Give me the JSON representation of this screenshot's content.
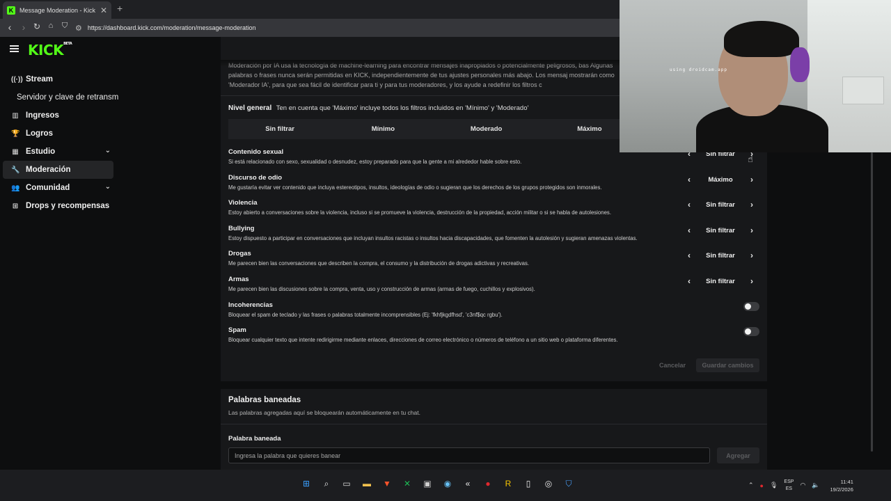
{
  "browser": {
    "tab_title": "Message Moderation - Kick Dash",
    "tab_favicon": "K",
    "url": "https://dashboard.kick.com/moderation/message-moderation"
  },
  "brand": {
    "logo": "KICK",
    "logo_badge": "BETA",
    "accent": "#53fc18"
  },
  "sidebar": {
    "items": [
      {
        "label": "Stream",
        "icon": "broadcast-icon",
        "glyph": "((·))"
      },
      {
        "label": "Servidor y clave de retransm",
        "sub": true
      },
      {
        "label": "Ingresos",
        "icon": "chart-icon",
        "glyph": "▥"
      },
      {
        "label": "Logros",
        "icon": "trophy-icon",
        "glyph": "🏆"
      },
      {
        "label": "Estudio",
        "icon": "film-icon",
        "glyph": "▦",
        "chevron": true
      },
      {
        "label": "Moderación",
        "icon": "wrench-icon",
        "glyph": "🔧",
        "active": true
      },
      {
        "label": "Comunidad",
        "icon": "community-icon",
        "glyph": "👥",
        "chevron": true
      },
      {
        "label": "Drops y recompensas",
        "icon": "drops-icon",
        "glyph": "⊞"
      }
    ]
  },
  "moderation": {
    "intro": "Moderación por IA usa la tecnología de machine-learning para encontrar mensajes inapropiados o potencialmente peligrosos, bas Algunas palabras o frases nunca serán permitidas en KICK, independientemente de tus ajustes personales más abajo. Los mensaj mostrarán como 'Moderador IA', para que sea fácil de identificar para ti y para tus moderadores, y los ayude a redefinir los filtros c",
    "general_label": "Nivel general",
    "general_note": "Ten en cuenta que 'Máximo' incluye todos los filtros incluidos en 'Mínimo' y 'Moderado'",
    "levels": [
      "Sin filtrar",
      "Mínimo",
      "Moderado",
      "Máximo"
    ],
    "categories": [
      {
        "title": "Contenido sexual",
        "desc": "Si está relacionado con sexo, sexualidad o desnudez, estoy preparado para que la gente a mi alrededor hable sobre esto.",
        "value": "Sin filtrar"
      },
      {
        "title": "Discurso de odio",
        "desc": "Me gustaría evitar ver contenido que incluya estereotipos, insultos, ideologías de odio o sugieran que los derechos de los grupos protegidos son inmorales.",
        "value": "Máximo"
      },
      {
        "title": "Violencia",
        "desc": "Estoy abierto a conversaciones sobre la violencia, incluso si se promueve la violencia, destrucción de la propiedad, acción militar o si se habla de autolesiones.",
        "value": "Sin filtrar"
      },
      {
        "title": "Bullying",
        "desc": "Estoy dispuesto a participar en conversaciones que incluyan insultos racistas o insultos hacia discapacidades, que fomenten la autolesión y sugieran amenazas violentas.",
        "value": "Sin filtrar"
      },
      {
        "title": "Drogas",
        "desc": "Me parecen bien las conversaciones que describen la compra, el consumo y la distribución de drogas adictivas y recreativas.",
        "value": "Sin filtrar"
      },
      {
        "title": "Armas",
        "desc": "Me parecen bien las discusiones sobre la compra, venta, uso y construcción de armas (armas de fuego, cuchillos y explosivos).",
        "value": "Sin filtrar"
      }
    ],
    "toggles": [
      {
        "title": "Incoherencias",
        "desc": "Bloquear el spam de teclado y las frases o palabras totalmente incomprensibles (Ej: 'fkhfjkgdfhsd', 'c3nf$qc rgbu').",
        "on": false
      },
      {
        "title": "Spam",
        "desc": "Bloquear cualquier texto que intente redirigirme mediante enlaces, direcciones de correo electrónico o números de teléfono a un sitio web o plataforma diferentes.",
        "on": false
      }
    ],
    "cancel_label": "Cancelar",
    "save_label": "Guardar cambios"
  },
  "banned": {
    "title": "Palabras baneadas",
    "subtitle": "Las palabras agregadas aquí se bloquearán automáticamente en tu chat.",
    "field_label": "Palabra baneada",
    "placeholder": "Ingresa la palabra que quieres banear",
    "add_label": "Agregar"
  },
  "webcam": {
    "watermark": "using droidcam.app"
  },
  "taskbar": {
    "apps": [
      {
        "icon": "windows-start-icon",
        "glyph": "⊞",
        "color": "#3aa0ff"
      },
      {
        "icon": "search-icon",
        "glyph": "⌕",
        "color": "#e8e8e8"
      },
      {
        "icon": "task-view-icon",
        "glyph": "▭",
        "color": "#d8d8d8"
      },
      {
        "icon": "file-explorer-icon",
        "glyph": "▬",
        "color": "#f2c14e"
      },
      {
        "icon": "brave-browser-icon",
        "glyph": "▼",
        "color": "#fb542b"
      },
      {
        "icon": "xbox-icon",
        "glyph": "✕",
        "color": "#1db954"
      },
      {
        "icon": "display-app-icon",
        "glyph": "▣",
        "color": "#cfcfcf"
      },
      {
        "icon": "steam-icon",
        "glyph": "◉",
        "color": "#66c0f4"
      },
      {
        "icon": "capcut-icon",
        "glyph": "«",
        "color": "#e8e8e8"
      },
      {
        "icon": "red-app-icon",
        "glyph": "●",
        "color": "#e0282e"
      },
      {
        "icon": "rockstar-icon",
        "glyph": "R",
        "color": "#f5c400"
      },
      {
        "icon": "document-icon",
        "glyph": "▯",
        "color": "#f0f0f0"
      },
      {
        "icon": "obs-icon",
        "glyph": "◎",
        "color": "#e8e8e8"
      },
      {
        "icon": "shield-app-icon",
        "glyph": "⛉",
        "color": "#4aa3ff"
      }
    ],
    "lang_top": "ESP",
    "lang_bottom": "ES",
    "time": "11:41",
    "date": "19/2/2026"
  }
}
